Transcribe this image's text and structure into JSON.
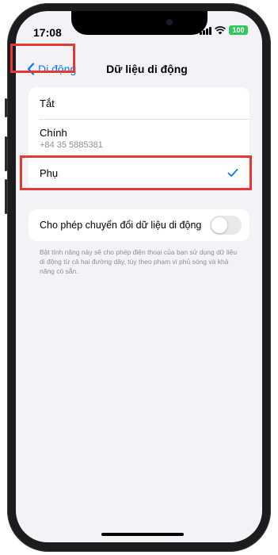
{
  "status_bar": {
    "time": "17:08",
    "battery": "100"
  },
  "nav": {
    "back_label": "Di động",
    "title": "Dữ liệu di động"
  },
  "options": [
    {
      "label": "Tắt",
      "sub": ""
    },
    {
      "label": "Chính",
      "sub": "+84 35 5885381"
    },
    {
      "label": "Phụ",
      "sub": "",
      "selected": true
    }
  ],
  "switching": {
    "label": "Cho phép chuyển đổi dữ liệu di động",
    "enabled": false,
    "footer": "Bật tính năng này sẽ cho phép điện thoại của bạn sử dụng dữ liệu di động từ cả hai đường dây, tùy theo phạm vi phủ sóng và khả năng có sẵn."
  },
  "colors": {
    "accent": "#007aff",
    "highlight": "#e53935",
    "battery": "#34c759",
    "background": "#f2f2f7"
  }
}
